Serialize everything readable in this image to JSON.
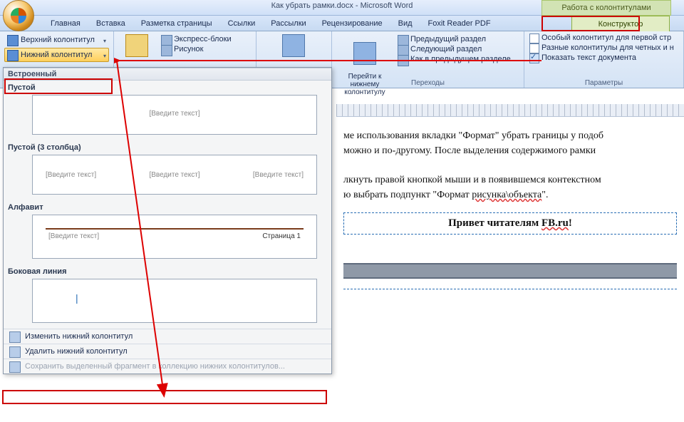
{
  "title": "Как убрать рамки.docx - Microsoft Word",
  "context_tab_group": "Работа с колонтитулами",
  "tabs": {
    "home": "Главная",
    "insert": "Вставка",
    "layout": "Разметка страницы",
    "refs": "Ссылки",
    "mail": "Рассылки",
    "review": "Рецензирование",
    "view": "Вид",
    "foxit": "Foxit Reader PDF",
    "design": "Конструктор"
  },
  "ribbon": {
    "hf_group": {
      "top": "Верхний колонтитул",
      "bottom": "Нижний колонтитул"
    },
    "insert_group": {
      "blocks": "Экспресс-блоки",
      "picture": "Рисунок"
    },
    "nav_group": {
      "goto_btn": "Перейти к нижнему\nколонтитулу",
      "prev": "Предыдущий раздел",
      "next": "Следующий раздел",
      "asprev": "Как в предыдущем разделе",
      "label": "Переходы"
    },
    "options_group": {
      "diff_first": "Особый колонтитул для первой стр",
      "diff_odd": "Разные колонтитулы для четных и н",
      "show_doc": "Показать текст документа",
      "label": "Параметры"
    }
  },
  "gallery": {
    "builtin": "Встроенный",
    "items": [
      {
        "name": "Пустой",
        "placeholders": [
          "[Введите текст]"
        ],
        "layout": "single"
      },
      {
        "name": "Пустой (3 столбца)",
        "placeholders": [
          "[Введите текст]",
          "[Введите текст]",
          "[Введите текст]"
        ],
        "layout": "three"
      },
      {
        "name": "Алфавит",
        "placeholders": [
          "[Введите текст]",
          "Страница 1"
        ],
        "layout": "alpha"
      },
      {
        "name": "Боковая линия",
        "placeholders": [
          "|"
        ],
        "layout": "side"
      }
    ],
    "menu": {
      "edit": "Изменить нижний колонтитул",
      "remove": "Удалить нижний колонтитул",
      "save": "Сохранить выделенный фрагмент в коллекцию нижних колонтитулов..."
    }
  },
  "document": {
    "p1": "ме использования вкладки \"Формат\" убрать границы у подоб",
    "p2": "можно и по-другому. После выделения содержимого рамки",
    "p3a": "лкнуть правой кнопкой мыши и в появившемся контекстном",
    "p3b_prefix": "ю выбрать подпункт \"Формат ",
    "p3b_link": "рисунка\\объекта",
    "p3b_suffix": "\".",
    "footer_text_prefix": "Привет читателям ",
    "footer_text_link": "FB.ru",
    "footer_text_suffix": "!"
  }
}
